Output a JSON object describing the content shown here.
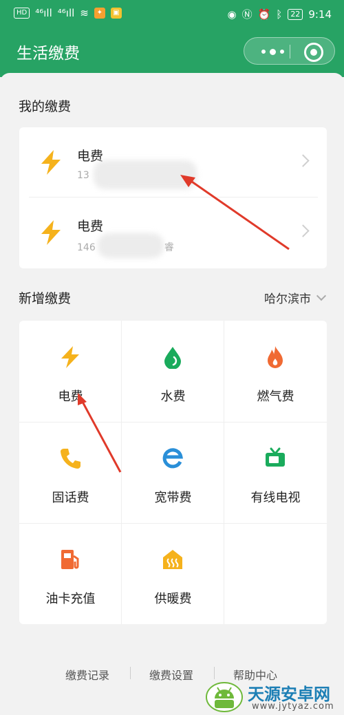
{
  "statusbar": {
    "left_tags": [
      "HD",
      "⁴⁶ıll",
      "⁴⁶ıll",
      "≋"
    ],
    "right_icons": [
      "eye-icon",
      "nfc-icon",
      "alarm-icon",
      "bluetooth-icon"
    ],
    "battery": "22",
    "time": "9:14"
  },
  "header": {
    "title": "生活缴费"
  },
  "my_bills": {
    "section_title": "我的缴费",
    "items": [
      {
        "name": "电费",
        "sub": "13",
        "icon": "lightning-icon"
      },
      {
        "name": "电费",
        "sub": "146",
        "sub_tail": "睿",
        "icon": "lightning-icon"
      }
    ]
  },
  "new_bills": {
    "section_title": "新增缴费",
    "city": "哈尔滨市",
    "items": [
      {
        "label": "电费",
        "icon": "lightning-icon",
        "color": "#f5b21c"
      },
      {
        "label": "水费",
        "icon": "water-drop-icon",
        "color": "#1aab5c"
      },
      {
        "label": "燃气费",
        "icon": "flame-icon",
        "color": "#f06a33"
      },
      {
        "label": "固话费",
        "icon": "phone-icon",
        "color": "#f5b21c"
      },
      {
        "label": "宽带费",
        "icon": "broadband-e-icon",
        "color": "#2a8fd8"
      },
      {
        "label": "有线电视",
        "icon": "tv-icon",
        "color": "#1aab5c"
      },
      {
        "label": "油卡充值",
        "icon": "fuel-pump-icon",
        "color": "#f06a33"
      },
      {
        "label": "供暖费",
        "icon": "heating-icon",
        "color": "#f5b21c"
      }
    ]
  },
  "footer": {
    "links": [
      "缴费记录",
      "缴费设置",
      "帮助中心"
    ]
  },
  "watermark": {
    "title": "天源安卓网",
    "url": "www.jytyaz.com"
  },
  "colors": {
    "brand": "#27a364",
    "arrow": "#e03a2a"
  }
}
